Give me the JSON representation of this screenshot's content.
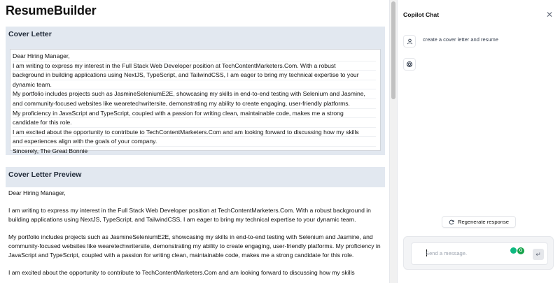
{
  "app": {
    "title": "ResumeBuilder"
  },
  "cover_letter": {
    "heading": "Cover Letter",
    "lines": [
      "Dear Hiring Manager,",
      "I am writing to express my interest in the Full Stack Web Developer position at TechContentMarketers.Com. With a robust",
      "background in building applications using NextJS, TypeScript, and TailwindCSS, I am eager to bring my technical expertise to your",
      "dynamic team.",
      "My portfolio includes projects such as JasmineSeleniumE2E, showcasing my skills in end-to-end testing with Selenium and Jasmine,",
      "and community-focused websites like wearetechwritersite, demonstrating my ability to create engaging, user-friendly platforms.",
      "My proficiency in JavaScript and TypeScript, coupled with a passion for writing clean, maintainable code, makes me a strong",
      "candidate for this role.",
      "I am excited about the opportunity to contribute to TechContentMarketers.Com and am looking forward to discussing how my skills",
      "and experiences align with the goals of your company.",
      "Sincerely, The Great Bonnie"
    ]
  },
  "preview": {
    "heading": "Cover Letter Preview",
    "p1": "Dear Hiring Manager,",
    "p2": "I am writing to express my interest in the Full Stack Web Developer position at TechContentMarketers.Com. With a robust background in building applications using NextJS, TypeScript, and TailwindCSS, I am eager to bring my technical expertise to your dynamic team.",
    "p3": "My portfolio includes projects such as JasmineSeleniumE2E, showcasing my skills in end-to-end testing with Selenium and Jasmine, and community-focused websites like wearetechwritersite, demonstrating my ability to create engaging, user-friendly platforms. My proficiency in JavaScript and TypeScript, coupled with a passion for writing clean, maintainable code, makes me a strong candidate for this role.",
    "p4": "I am excited about the opportunity to contribute to TechContentMarketers.Com and am looking forward to discussing how my skills"
  },
  "copilot": {
    "title": "Copilot Chat",
    "user_message": "create a cover letter and resume",
    "regenerate_label": "Regenerate response",
    "input_placeholder": "Send a message.",
    "ext_badge": "G",
    "send_glyph": "↵",
    "close_glyph": "✕"
  },
  "colors": {
    "panel_bg": "#e2e8f0",
    "accent_green": "#10b981"
  },
  "icons": [
    "close-icon",
    "user-icon",
    "openai-icon",
    "refresh-icon",
    "send-icon"
  ]
}
